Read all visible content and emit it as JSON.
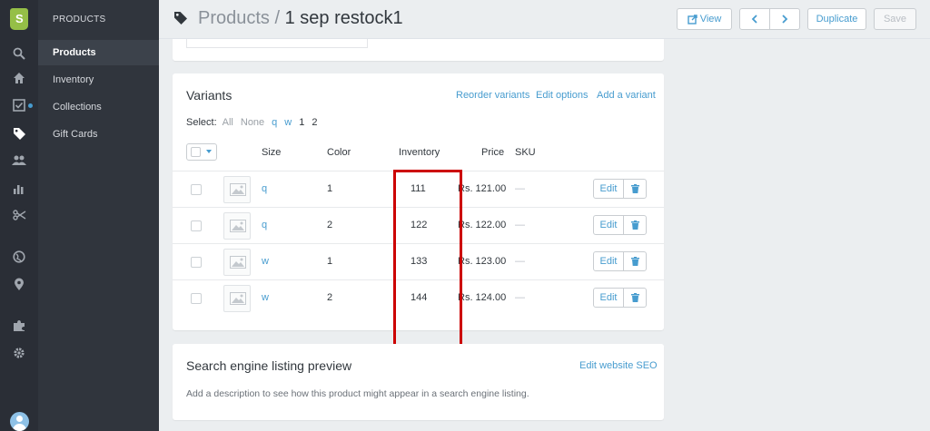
{
  "sidebar": {
    "icons": [
      "shopify-logo-icon",
      "search-icon",
      "home-icon",
      "orders-icon",
      "products-tag-icon",
      "customers-icon",
      "reports-icon",
      "discounts-icon",
      "online-store-globe-icon",
      "location-pin-icon",
      "apps-puzzle-icon",
      "settings-gear-icon",
      "user-avatar-icon"
    ],
    "active_icon": "products-tag-icon"
  },
  "subnav": {
    "heading": "PRODUCTS",
    "items": [
      {
        "label": "Products",
        "active": true
      },
      {
        "label": "Inventory",
        "active": false
      },
      {
        "label": "Collections",
        "active": false
      },
      {
        "label": "Gift Cards",
        "active": false
      }
    ]
  },
  "header": {
    "breadcrumb": "Products",
    "separator": " / ",
    "title": "1 sep restock1",
    "buttons": {
      "view": "View",
      "duplicate": "Duplicate",
      "save": "Save"
    }
  },
  "variants_card": {
    "title": "Variants",
    "links": {
      "reorder": "Reorder variants",
      "edit_options": "Edit options",
      "add_variant": "Add a variant"
    },
    "select": {
      "label": "Select:",
      "all": "All",
      "none": "None",
      "q": "q",
      "w": "w",
      "one": "1",
      "two": "2"
    },
    "columns": {
      "size": "Size",
      "color": "Color",
      "inventory": "Inventory",
      "price": "Price",
      "sku": "SKU"
    },
    "rows": [
      {
        "size": "q",
        "color": "1",
        "inventory": "111",
        "price": "Rs. 121.00",
        "sku": "—",
        "edit": "Edit"
      },
      {
        "size": "q",
        "color": "2",
        "inventory": "122",
        "price": "Rs. 122.00",
        "sku": "—",
        "edit": "Edit"
      },
      {
        "size": "w",
        "color": "1",
        "inventory": "133",
        "price": "Rs. 123.00",
        "sku": "—",
        "edit": "Edit"
      },
      {
        "size": "w",
        "color": "2",
        "inventory": "144",
        "price": "Rs. 124.00",
        "sku": "—",
        "edit": "Edit"
      }
    ]
  },
  "seo_card": {
    "title": "Search engine listing preview",
    "link": "Edit website SEO",
    "description": "Add a description to see how this product might appear in a search engine listing."
  },
  "colors": {
    "accent": "#479ccf",
    "highlight": "#cc0000",
    "rail_bg": "#2a2e36",
    "subnav_bg": "#30353d"
  }
}
